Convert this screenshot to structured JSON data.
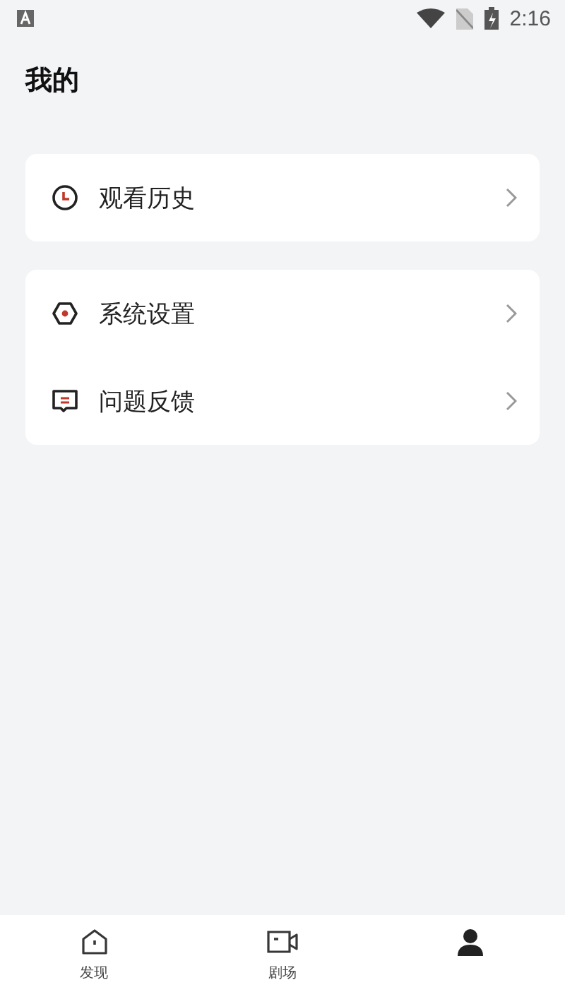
{
  "status_bar": {
    "time": "2:16"
  },
  "header": {
    "title": "我的"
  },
  "groups": [
    {
      "items": [
        {
          "kind": "clock",
          "label": "观看历史"
        }
      ]
    },
    {
      "items": [
        {
          "kind": "hexagon",
          "label": "系统设置"
        },
        {
          "kind": "message",
          "label": "问题反馈"
        }
      ]
    }
  ],
  "bottom_nav": [
    {
      "kind": "home",
      "label": "发现",
      "selected": false
    },
    {
      "kind": "camera",
      "label": "剧场",
      "selected": false
    },
    {
      "kind": "person",
      "selected": true
    }
  ]
}
